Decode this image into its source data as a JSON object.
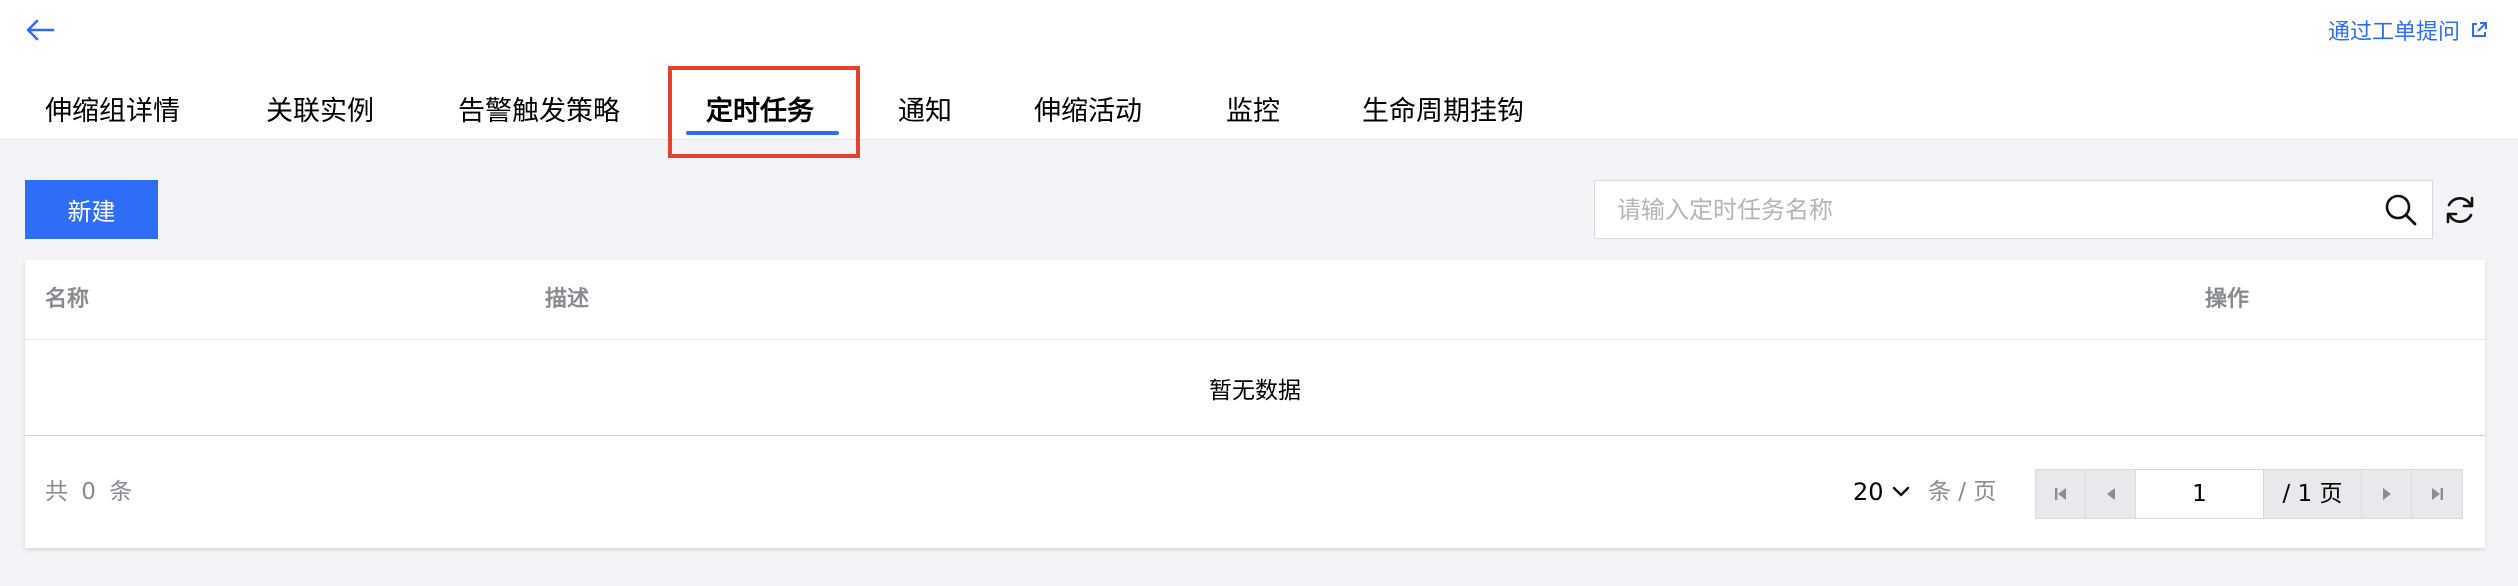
{
  "header": {
    "back_icon": "arrow-left-icon",
    "ticket_link_label": "通过工单提问",
    "ticket_link_icon": "external-link-icon",
    "accent_color": "#2e6ef6"
  },
  "tabs": [
    {
      "label": "伸缩组详情",
      "active": false
    },
    {
      "label": "关联实例",
      "active": false
    },
    {
      "label": "告警触发策略",
      "active": false
    },
    {
      "label": "定时任务",
      "active": true
    },
    {
      "label": "通知",
      "active": false
    },
    {
      "label": "伸缩活动",
      "active": false
    },
    {
      "label": "监控",
      "active": false
    },
    {
      "label": "生命周期挂钩",
      "active": false
    }
  ],
  "highlight_color": "#e5422d",
  "toolbar": {
    "new_button_label": "新建",
    "search_placeholder": "请输入定时任务名称",
    "search_value": "",
    "search_icon": "search-icon",
    "refresh_icon": "refresh-icon"
  },
  "table": {
    "columns": [
      "名称",
      "描述",
      "操作"
    ],
    "rows": [],
    "empty_text": "暂无数据"
  },
  "pagination": {
    "total_text": "共 0 条",
    "page_size": "20",
    "per_page_label": "条 / 页",
    "current_page": "1",
    "total_pages_text": "/ 1 页"
  }
}
